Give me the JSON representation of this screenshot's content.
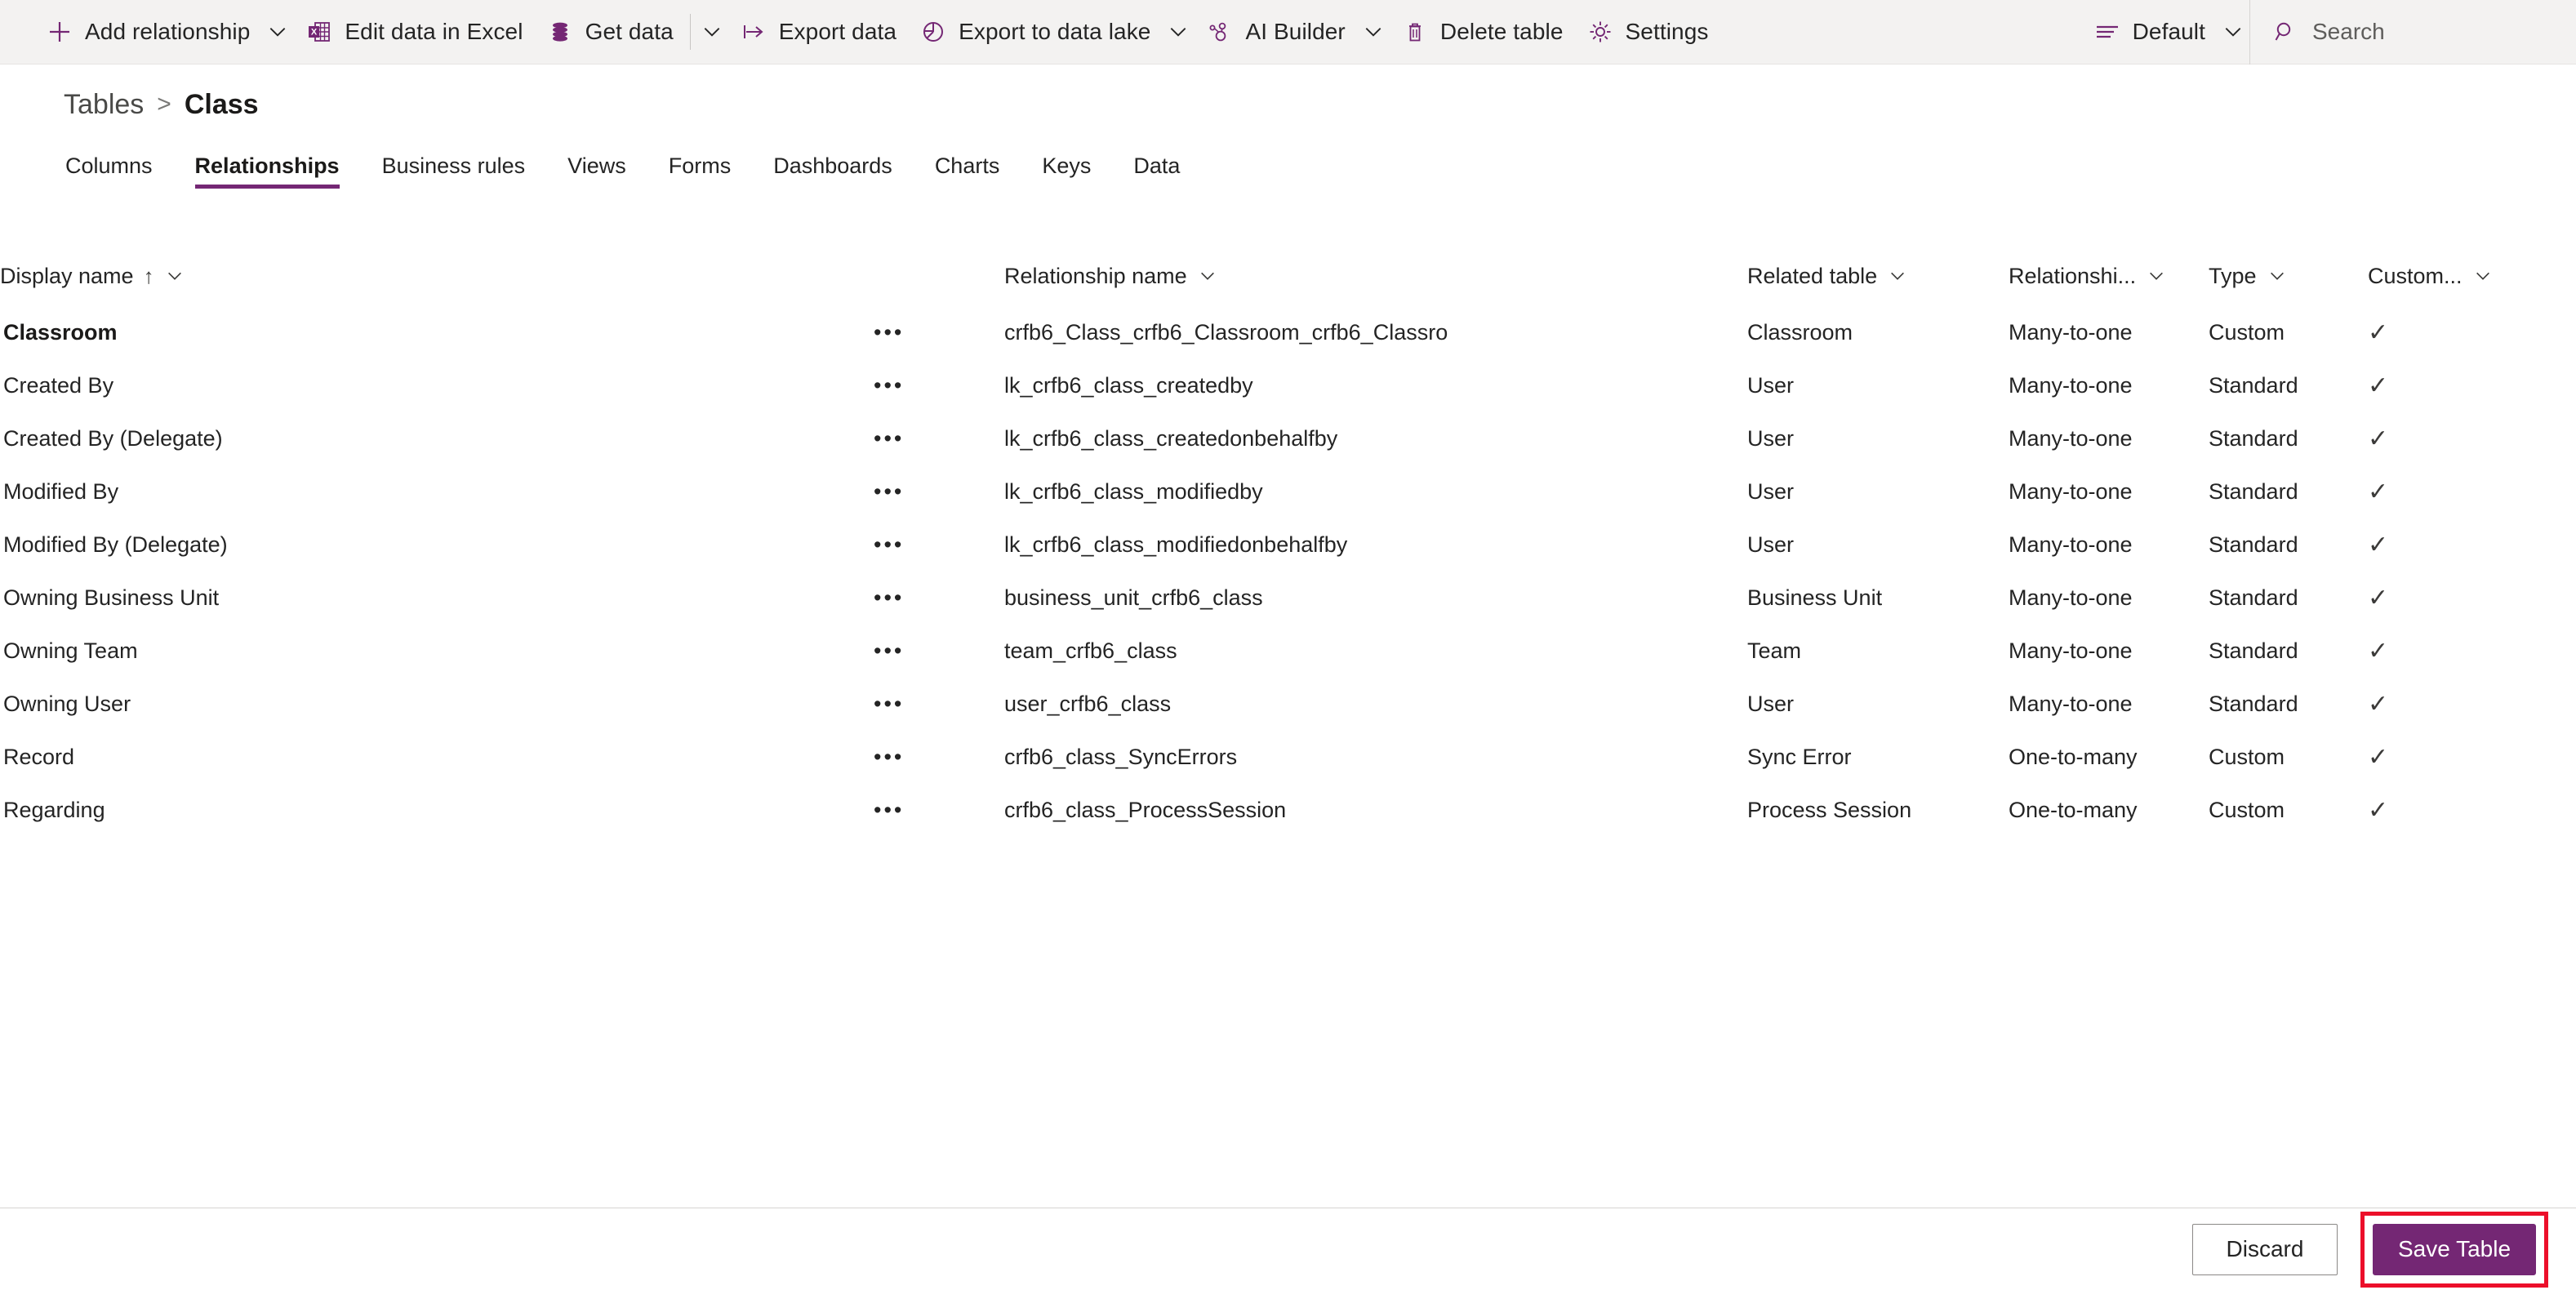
{
  "commandbar": {
    "items": [
      {
        "label": "Add relationship",
        "icon": "plus-icon",
        "has_chevron": true
      },
      {
        "label": "Edit data in Excel",
        "icon": "excel-icon",
        "has_chevron": false
      },
      {
        "label": "Get data",
        "icon": "database-icon",
        "has_chevron": true,
        "sep_before": true,
        "sep_after": true
      },
      {
        "label": "Export data",
        "icon": "export-icon",
        "has_chevron": false
      },
      {
        "label": "Export to data lake",
        "icon": "datalake-pie-icon",
        "has_chevron": true
      },
      {
        "label": "AI Builder",
        "icon": "ai-builder-icon",
        "has_chevron": true
      },
      {
        "label": "Delete table",
        "icon": "trash-icon",
        "has_chevron": false
      },
      {
        "label": "Settings",
        "icon": "gear-icon",
        "has_chevron": false
      }
    ],
    "view_selector": {
      "label": "Default",
      "icon": "list-view-icon"
    },
    "search": {
      "placeholder": "Search",
      "icon": "search-icon"
    }
  },
  "breadcrumb": {
    "parent": "Tables",
    "separator": ">",
    "current": "Class"
  },
  "tabs": [
    {
      "label": "Columns",
      "active": false
    },
    {
      "label": "Relationships",
      "active": true
    },
    {
      "label": "Business rules",
      "active": false
    },
    {
      "label": "Views",
      "active": false
    },
    {
      "label": "Forms",
      "active": false
    },
    {
      "label": "Dashboards",
      "active": false
    },
    {
      "label": "Charts",
      "active": false
    },
    {
      "label": "Keys",
      "active": false
    },
    {
      "label": "Data",
      "active": false
    }
  ],
  "grid": {
    "columns": [
      {
        "label": "Display name",
        "sorted": true,
        "sort_arrow": "↑"
      },
      {
        "label": "Relationship name",
        "sorted": false
      },
      {
        "label": "Related table",
        "sorted": false
      },
      {
        "label": "Relationshi...",
        "sorted": false
      },
      {
        "label": "Type",
        "sorted": false
      },
      {
        "label": "Custom...",
        "sorted": false
      }
    ],
    "rows": [
      {
        "display_name": "Classroom",
        "bold": true,
        "relationship_name": "crfb6_Class_crfb6_Classroom_crfb6_Classro",
        "related_table": "Classroom",
        "relationship_type": "Many-to-one",
        "type": "Custom",
        "customizable": "✓"
      },
      {
        "display_name": "Created By",
        "bold": false,
        "relationship_name": "lk_crfb6_class_createdby",
        "related_table": "User",
        "relationship_type": "Many-to-one",
        "type": "Standard",
        "customizable": "✓"
      },
      {
        "display_name": "Created By (Delegate)",
        "bold": false,
        "relationship_name": "lk_crfb6_class_createdonbehalfby",
        "related_table": "User",
        "relationship_type": "Many-to-one",
        "type": "Standard",
        "customizable": "✓"
      },
      {
        "display_name": "Modified By",
        "bold": false,
        "relationship_name": "lk_crfb6_class_modifiedby",
        "related_table": "User",
        "relationship_type": "Many-to-one",
        "type": "Standard",
        "customizable": "✓"
      },
      {
        "display_name": "Modified By (Delegate)",
        "bold": false,
        "relationship_name": "lk_crfb6_class_modifiedonbehalfby",
        "related_table": "User",
        "relationship_type": "Many-to-one",
        "type": "Standard",
        "customizable": "✓"
      },
      {
        "display_name": "Owning Business Unit",
        "bold": false,
        "relationship_name": "business_unit_crfb6_class",
        "related_table": "Business Unit",
        "relationship_type": "Many-to-one",
        "type": "Standard",
        "customizable": "✓"
      },
      {
        "display_name": "Owning Team",
        "bold": false,
        "relationship_name": "team_crfb6_class",
        "related_table": "Team",
        "relationship_type": "Many-to-one",
        "type": "Standard",
        "customizable": "✓"
      },
      {
        "display_name": "Owning User",
        "bold": false,
        "relationship_name": "user_crfb6_class",
        "related_table": "User",
        "relationship_type": "Many-to-one",
        "type": "Standard",
        "customizable": "✓"
      },
      {
        "display_name": "Record",
        "bold": false,
        "relationship_name": "crfb6_class_SyncErrors",
        "related_table": "Sync Error",
        "relationship_type": "One-to-many",
        "type": "Custom",
        "customizable": "✓"
      },
      {
        "display_name": "Regarding",
        "bold": false,
        "relationship_name": "crfb6_class_ProcessSession",
        "related_table": "Process Session",
        "relationship_type": "One-to-many",
        "type": "Custom",
        "customizable": "✓"
      }
    ],
    "row_menu_glyph": "•••"
  },
  "footer": {
    "discard_label": "Discard",
    "save_label": "Save Table"
  },
  "colors": {
    "accent_purple": "#742774",
    "highlight_red": "#ec0f2a",
    "commandbar_bg": "#f3f2f1",
    "text_primary": "#242424",
    "text_secondary": "#605e5c"
  }
}
